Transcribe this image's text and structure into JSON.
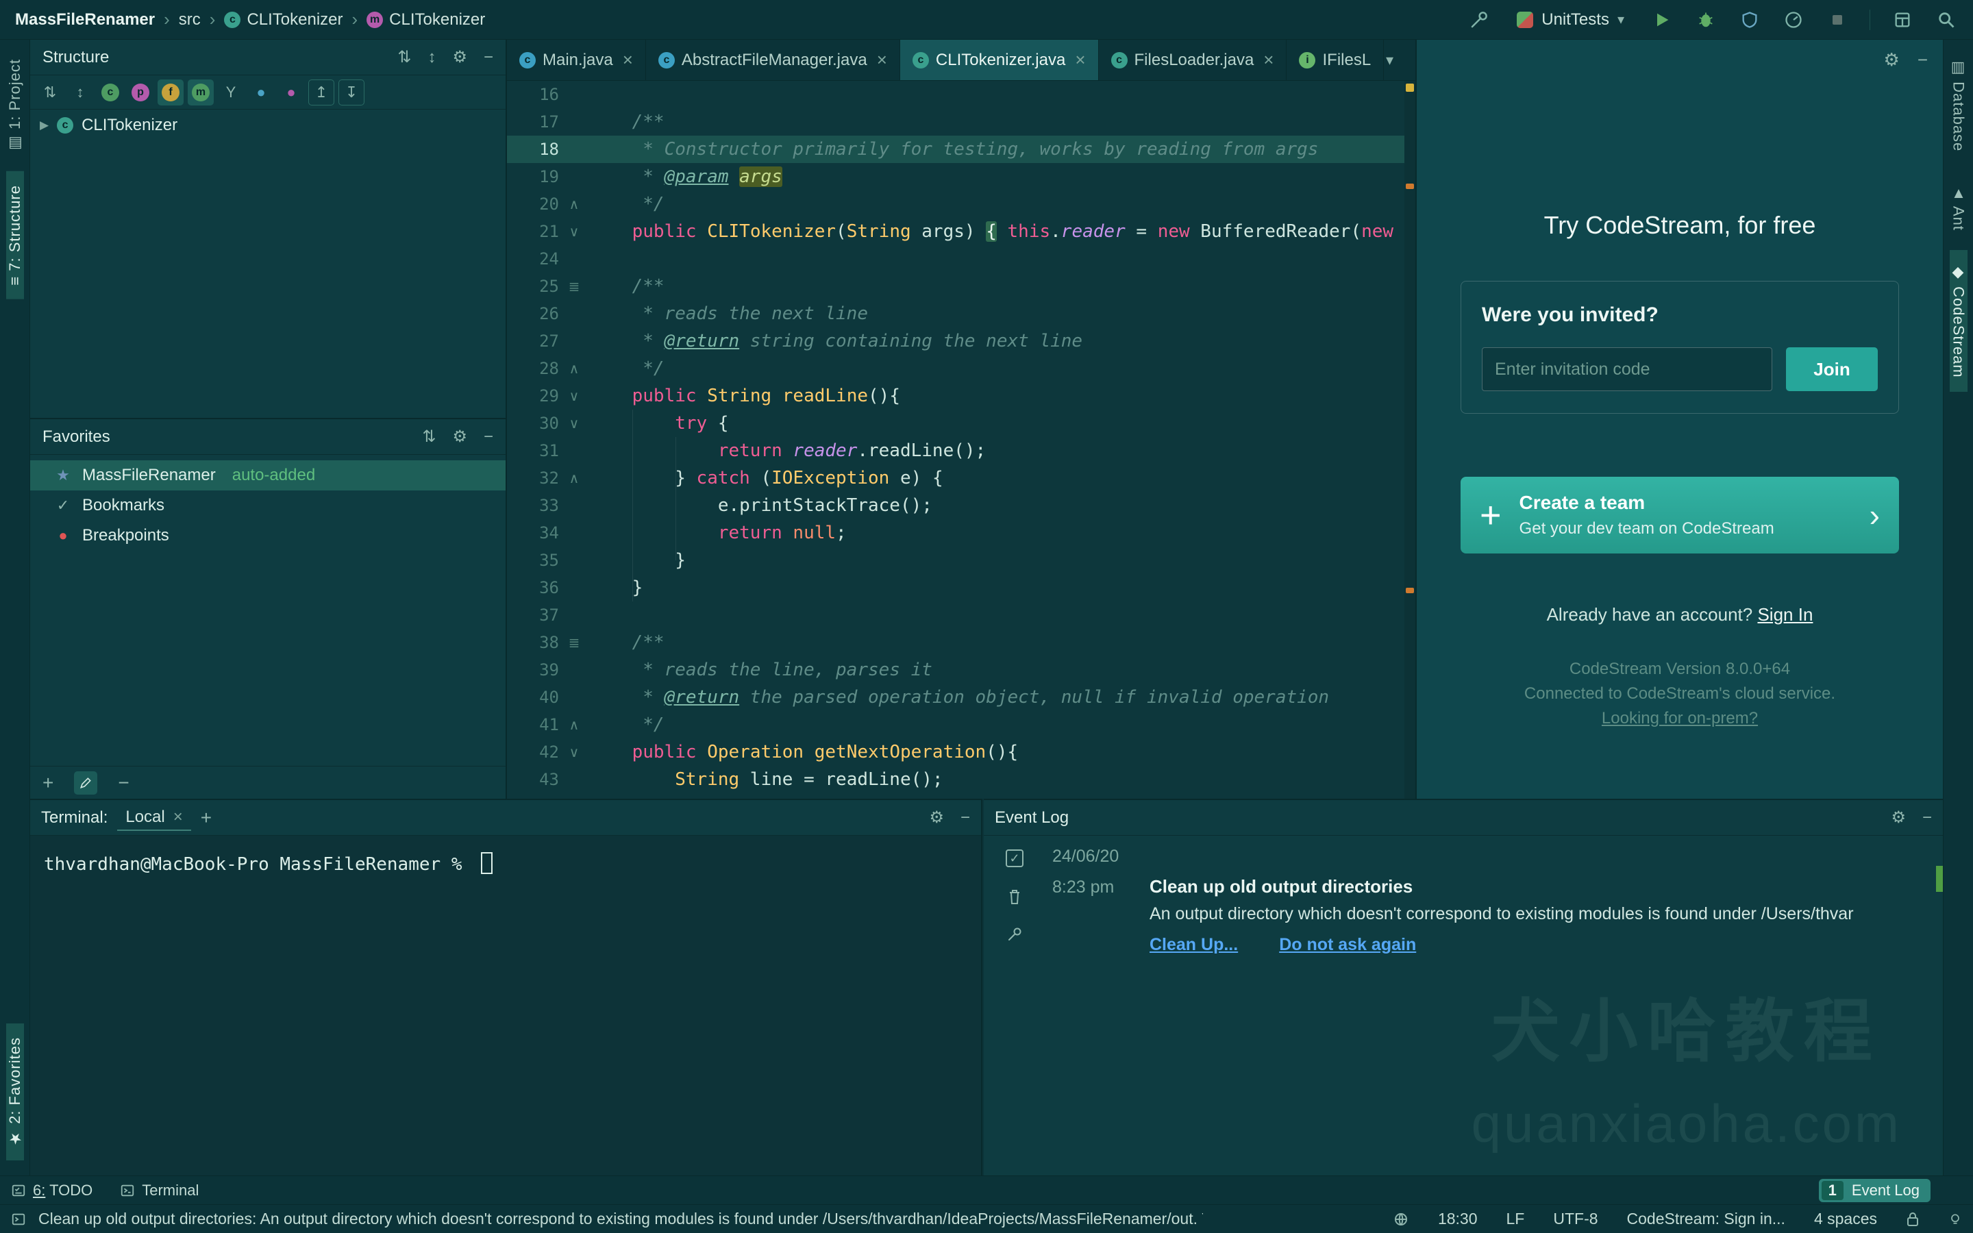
{
  "titlebar": {
    "breadcrumbs": [
      {
        "label": "MassFileRenamer"
      },
      {
        "label": "src"
      },
      {
        "label": "CLITokenizer",
        "icon": "c",
        "icon_color": "#3aa08d"
      },
      {
        "label": "CLITokenizer",
        "icon": "m",
        "icon_color": "#b45bac"
      }
    ],
    "run_config": "UnitTests"
  },
  "toolstrips": {
    "left_top": [
      {
        "label": "1: Project",
        "glyph": "▤"
      },
      {
        "label": "7: Structure",
        "glyph": "≡",
        "active": true
      }
    ],
    "left_bottom": [
      {
        "label": "2: Favorites",
        "glyph": "★",
        "active": true
      }
    ],
    "right": [
      {
        "label": "Database",
        "glyph": "▥"
      },
      {
        "label": "Ant",
        "glyph": "▲"
      },
      {
        "label": "CodeStream",
        "glyph": "◆",
        "active": true
      }
    ]
  },
  "structure_panel": {
    "title": "Structure",
    "toolbar": [
      {
        "name": "sort-alphabetically-icon",
        "glyph": "⇅"
      },
      {
        "name": "sort-by-visibility-icon",
        "glyph": "↕"
      },
      {
        "name": "show-classes-icon",
        "glyph": "c",
        "circle": "#4e9c62"
      },
      {
        "name": "show-properties-icon",
        "glyph": "p",
        "circle": "#b45bac"
      },
      {
        "name": "show-fields-icon",
        "glyph": "f",
        "circle": "#c7a23c",
        "boxed": true
      },
      {
        "name": "show-methods-icon",
        "glyph": "m",
        "circle": "#4e9c62",
        "boxed": true
      },
      {
        "name": "show-inherited-icon",
        "glyph": "Y"
      },
      {
        "name": "visibility-public-icon",
        "glyph": "●",
        "color": "#4aa3c6"
      },
      {
        "name": "visibility-private-icon",
        "glyph": "●",
        "color": "#b45bac"
      },
      {
        "name": "expand-all-icon",
        "glyph": "↥",
        "outlined": true
      },
      {
        "name": "collapse-all-icon",
        "glyph": "↧",
        "outlined": true
      }
    ],
    "tree": [
      {
        "label": "CLITokenizer"
      }
    ]
  },
  "favorites_panel": {
    "title": "Favorites",
    "items": [
      {
        "label": "MassFileRenamer",
        "suffix": "auto-added",
        "icon": "star",
        "icon_color": "#6f93b8",
        "selected": true
      },
      {
        "label": "Bookmarks",
        "icon": "check",
        "icon_color": "#8fb5ad"
      },
      {
        "label": "Breakpoints",
        "icon": "dot",
        "icon_color": "#e05555"
      }
    ]
  },
  "editor": {
    "tabs": [
      {
        "label": "Main.java",
        "icon": "c",
        "icon_color": "#3b9fc2",
        "closable": true
      },
      {
        "label": "AbstractFileManager.java",
        "icon": "c",
        "icon_color": "#3b9fc2",
        "closable": true
      },
      {
        "label": "CLITokenizer.java",
        "icon": "c",
        "icon_color": "#3aa08d",
        "closable": true,
        "active": true
      },
      {
        "label": "FilesLoader.java",
        "icon": "c",
        "icon_color": "#3aa08d",
        "closable": true
      },
      {
        "label": "IFilesL",
        "icon": "i",
        "icon_color": "#66b56b",
        "closable": false
      }
    ],
    "lines": [
      {
        "n": 16,
        "t": []
      },
      {
        "n": 17,
        "t": [
          [
            "    /**",
            "cmt"
          ]
        ]
      },
      {
        "n": 18,
        "t": [
          [
            "     * Constructor primarily for testing, works by reading from args",
            "cmt"
          ]
        ],
        "active": true
      },
      {
        "n": 19,
        "t": [
          [
            "     * ",
            "cmt"
          ],
          [
            "@param",
            "tag"
          ],
          [
            " ",
            "cmt"
          ],
          [
            "args",
            "hl"
          ]
        ]
      },
      {
        "n": 20,
        "t": [
          [
            "     */",
            "cmt"
          ]
        ],
        "g": "up"
      },
      {
        "n": 21,
        "t": [
          [
            "    ",
            "pln"
          ],
          [
            "public ",
            "kw"
          ],
          [
            "CLITokenizer",
            "mth"
          ],
          [
            "(",
            "pln"
          ],
          [
            "String",
            "cls"
          ],
          [
            " args) ",
            "pln"
          ],
          [
            "{",
            "brc"
          ],
          [
            " ",
            "pln"
          ],
          [
            "this",
            "kw"
          ],
          [
            ".",
            "pln"
          ],
          [
            "reader",
            "fld"
          ],
          [
            " = ",
            "pln"
          ],
          [
            "new",
            "kw"
          ],
          [
            " BufferedReader(",
            "pln"
          ],
          [
            "new",
            "kw"
          ]
        ],
        "g": "down"
      },
      {
        "n": 24,
        "t": []
      },
      {
        "n": 25,
        "t": [
          [
            "    /**",
            "cmt"
          ]
        ],
        "g": "list"
      },
      {
        "n": 26,
        "t": [
          [
            "     * reads the next line",
            "cmt"
          ]
        ]
      },
      {
        "n": 27,
        "t": [
          [
            "     * ",
            "cmt"
          ],
          [
            "@return",
            "tag"
          ],
          [
            " string containing the next line",
            "cmt"
          ]
        ]
      },
      {
        "n": 28,
        "t": [
          [
            "     */",
            "cmt"
          ]
        ],
        "g": "up"
      },
      {
        "n": 29,
        "t": [
          [
            "    ",
            "pln"
          ],
          [
            "public ",
            "kw"
          ],
          [
            "String",
            "cls"
          ],
          [
            " ",
            "pln"
          ],
          [
            "readLine",
            "mth"
          ],
          [
            "(){",
            "pln"
          ]
        ],
        "g": "down"
      },
      {
        "n": 30,
        "t": [
          [
            "        ",
            "pln"
          ],
          [
            "try",
            "kw"
          ],
          [
            " {",
            "pln"
          ]
        ],
        "g": "down"
      },
      {
        "n": 31,
        "t": [
          [
            "            ",
            "pln"
          ],
          [
            "return",
            "kw"
          ],
          [
            " ",
            "pln"
          ],
          [
            "reader",
            "fld"
          ],
          [
            ".readLine();",
            "pln"
          ]
        ]
      },
      {
        "n": 32,
        "t": [
          [
            "        } ",
            "pln"
          ],
          [
            "catch",
            "kw"
          ],
          [
            " (",
            "pln"
          ],
          [
            "IOException",
            "cls"
          ],
          [
            " e) {",
            "pln"
          ]
        ],
        "g": "up"
      },
      {
        "n": 33,
        "t": [
          [
            "            e.printStackTrace();",
            "pln"
          ]
        ]
      },
      {
        "n": 34,
        "t": [
          [
            "            ",
            "pln"
          ],
          [
            "return",
            "kw"
          ],
          [
            " ",
            "pln"
          ],
          [
            "null",
            "kw2"
          ],
          [
            ";",
            "pln"
          ]
        ]
      },
      {
        "n": 35,
        "t": [
          [
            "        }",
            "pln"
          ]
        ]
      },
      {
        "n": 36,
        "t": [
          [
            "    }",
            "pln"
          ]
        ]
      },
      {
        "n": 37,
        "t": []
      },
      {
        "n": 38,
        "t": [
          [
            "    /**",
            "cmt"
          ]
        ],
        "g": "list"
      },
      {
        "n": 39,
        "t": [
          [
            "     * reads the line, parses it",
            "cmt"
          ]
        ]
      },
      {
        "n": 40,
        "t": [
          [
            "     * ",
            "cmt"
          ],
          [
            "@return",
            "tag"
          ],
          [
            " the parsed operation object, null if invalid operation",
            "cmt"
          ]
        ]
      },
      {
        "n": 41,
        "t": [
          [
            "     */",
            "cmt"
          ]
        ],
        "g": "up"
      },
      {
        "n": 42,
        "t": [
          [
            "    ",
            "pln"
          ],
          [
            "public ",
            "kw"
          ],
          [
            "Operation",
            "cls"
          ],
          [
            " ",
            "pln"
          ],
          [
            "getNextOperation",
            "mth"
          ],
          [
            "(){",
            "pln"
          ]
        ],
        "g": "down"
      },
      {
        "n": 43,
        "t": [
          [
            "        ",
            "pln"
          ],
          [
            "String",
            "cls"
          ],
          [
            " line = readLine();",
            "pln"
          ]
        ]
      }
    ]
  },
  "codestream": {
    "title": "Try CodeStream, for free",
    "invite_heading": "Were you invited?",
    "invite_placeholder": "Enter invitation code",
    "join_label": "Join",
    "create_team_plus": "+",
    "create_team_title": "Create a team",
    "create_team_sub": "Get your dev team on CodeStream",
    "create_team_chevron": "›",
    "signin_prefix": "Already have an account?",
    "signin_link": "Sign In",
    "version": "CodeStream Version 8.0.0+64",
    "connected": "Connected to CodeStream's cloud service.",
    "onprem_link": "Looking for on-prem?"
  },
  "terminal": {
    "title": "Terminal:",
    "tab": "Local",
    "close": "×",
    "add_label": "+",
    "prompt": "thvardhan@MacBook-Pro MassFileRenamer %"
  },
  "event_log": {
    "title": "Event Log",
    "date": "24/06/20",
    "time": "8:23 pm",
    "event_title": "Clean up old output directories",
    "event_body": "An output directory which doesn't correspond to existing modules is found under /Users/thvar",
    "links": [
      "Clean Up...",
      "Do not ask again"
    ]
  },
  "dock": {
    "todo": "6: TODO",
    "terminal": "Terminal",
    "eventlog_count": "1",
    "eventlog_label": "Event Log"
  },
  "statusbar": {
    "message": "Clean up old output directories: An output directory which doesn't correspond to existing modules is found under /Users/thvardhan/IdeaProjects/MassFileRenamer/out. You m... (a minute ago)",
    "position": "18:30",
    "line_separator": "LF",
    "encoding": "UTF-8",
    "codestream": "CodeStream: Sign in...",
    "indent": "4 spaces"
  },
  "watermark": {
    "line1": "犬小哈教程",
    "line2": "quanxiaoha.com"
  }
}
